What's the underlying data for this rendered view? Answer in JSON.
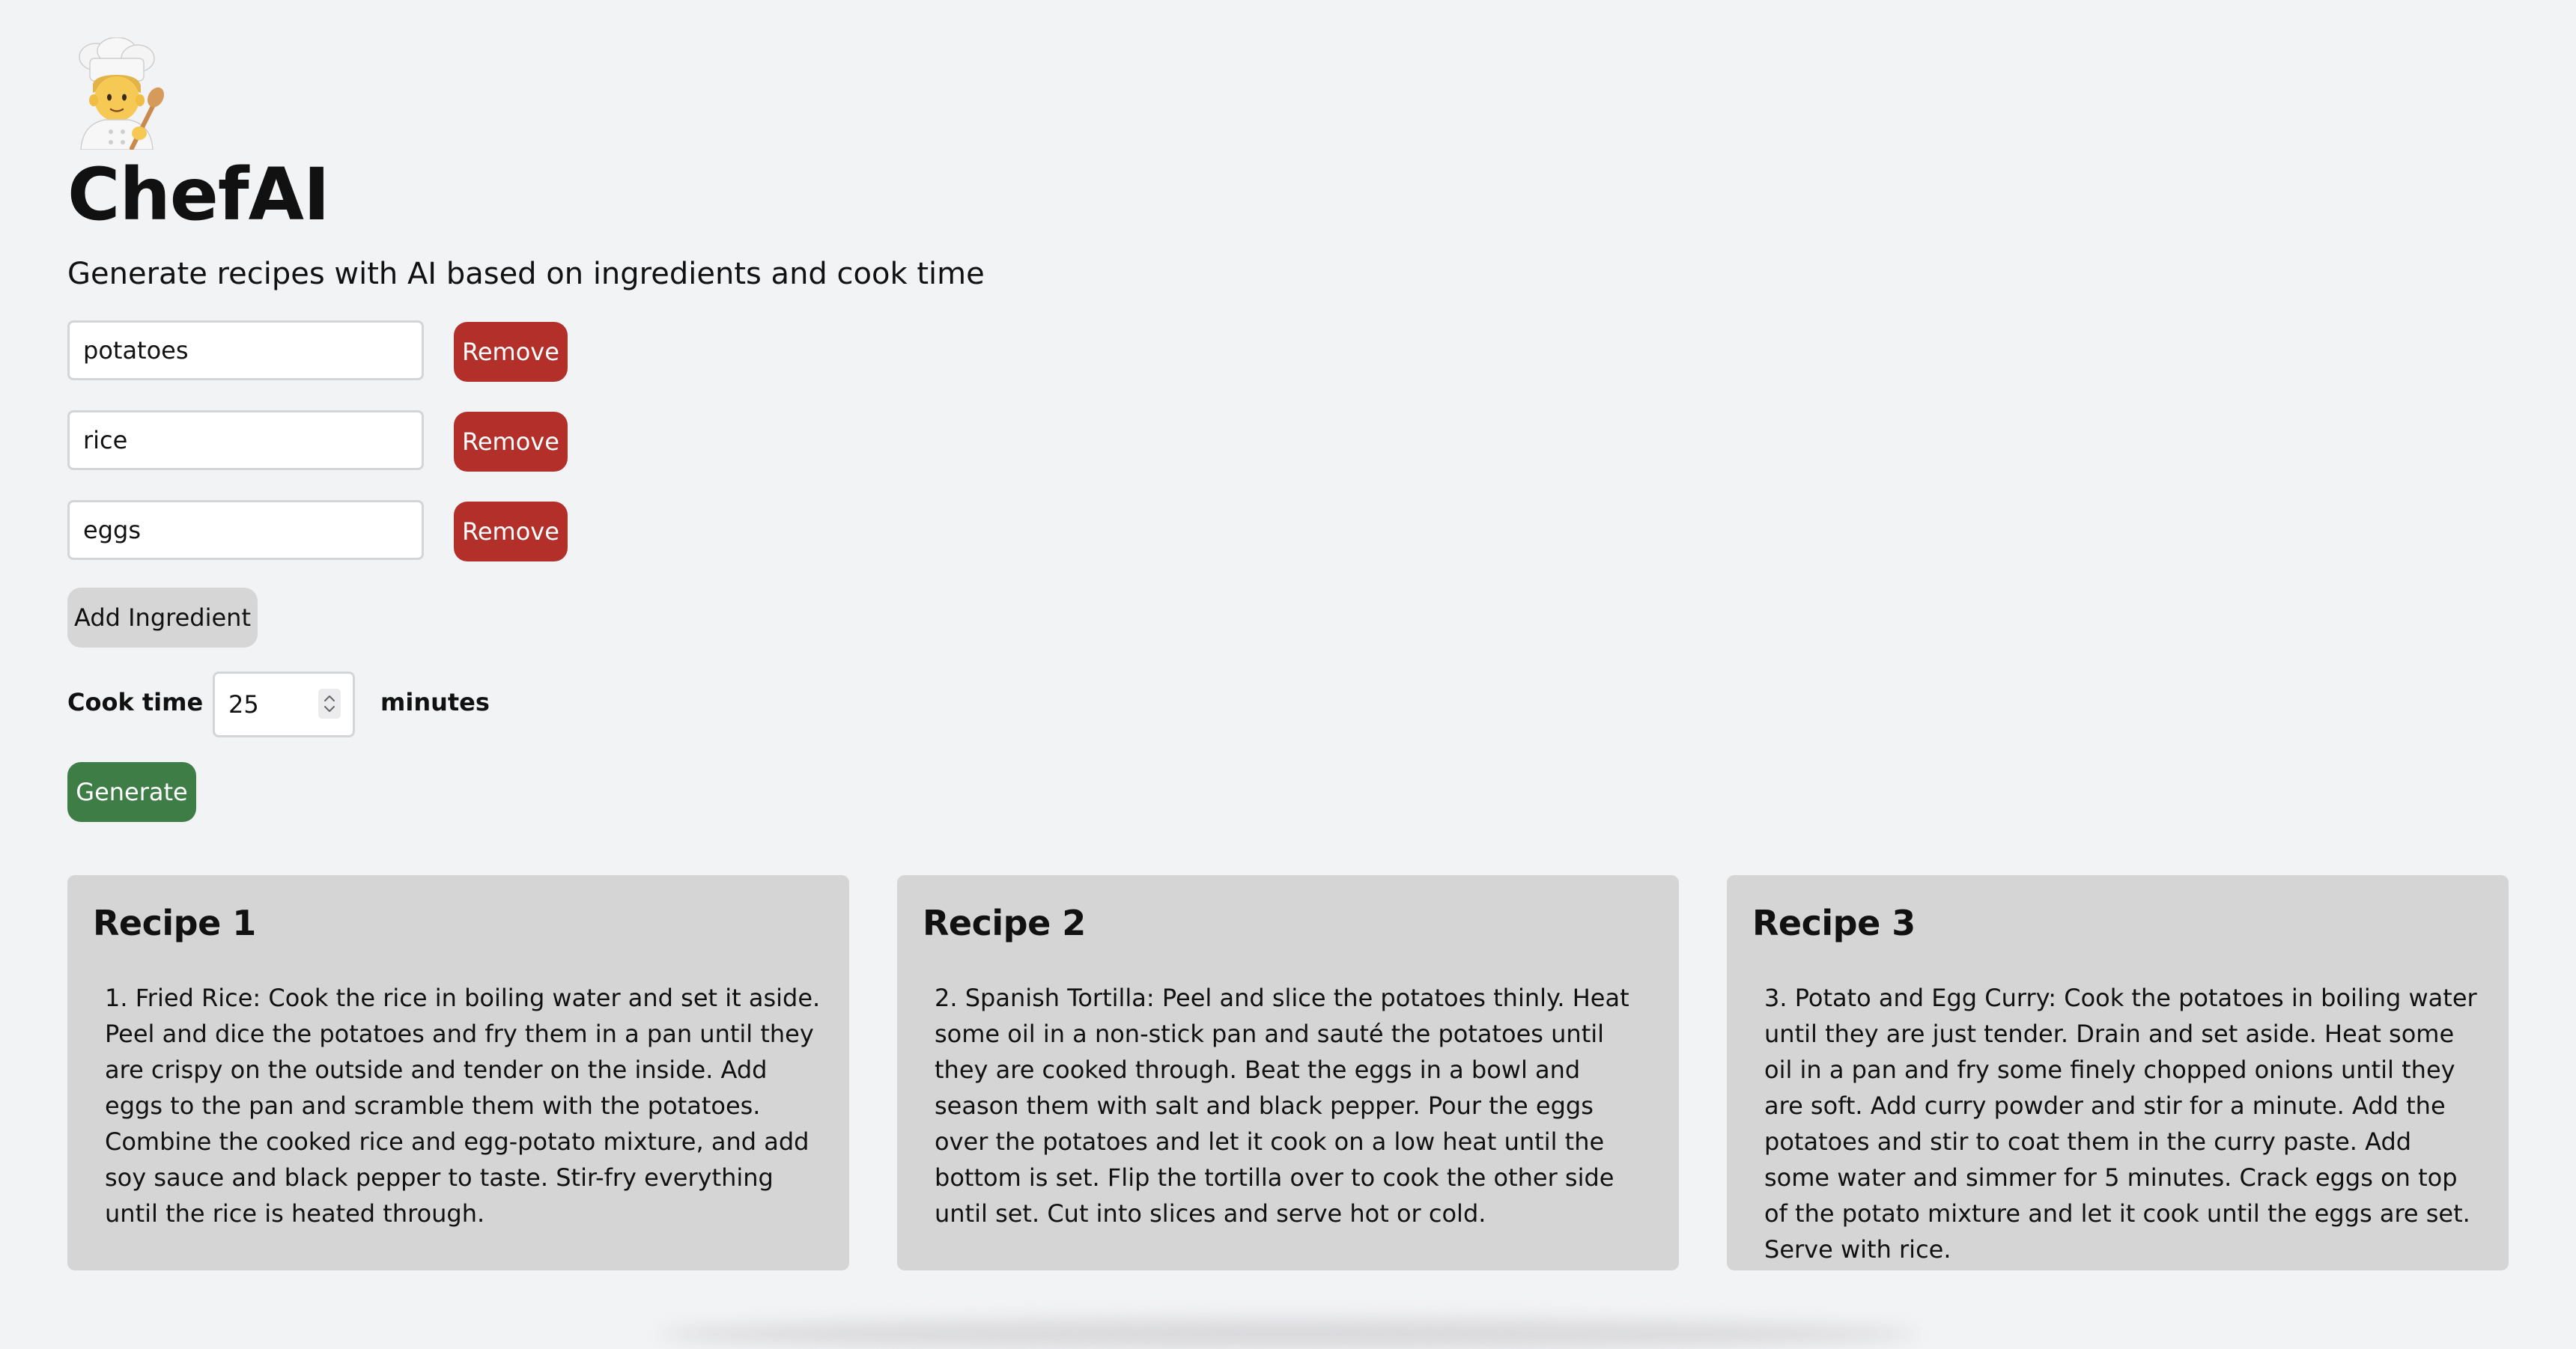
{
  "app": {
    "logo_icon": "chef-emoji-icon",
    "title": "ChefAI",
    "subtitle": "Generate recipes with AI based on ingredients and cook time"
  },
  "ingredients": [
    {
      "value": "potatoes",
      "remove_label": "Remove"
    },
    {
      "value": "rice",
      "remove_label": "Remove"
    },
    {
      "value": "eggs",
      "remove_label": "Remove"
    }
  ],
  "add_ingredient_label": "Add Ingredient",
  "cook_time": {
    "label": "Cook time",
    "value": "25",
    "unit": "minutes"
  },
  "generate_label": "Generate",
  "colors": {
    "remove": "#b3302a",
    "generate": "#3f7d47",
    "card": "#d5d5d5",
    "background": "#f2f3f5"
  },
  "recipes": [
    {
      "title": "Recipe 1",
      "body": "1. Fried Rice: Cook the rice in boiling water and set it aside. Peel and dice the potatoes and fry them in a pan until they are crispy on the outside and tender on the inside. Add eggs to the pan and scramble them with the potatoes. Combine the cooked rice and egg-potato mixture, and add soy sauce and black pepper to taste. Stir-fry everything until the rice is heated through."
    },
    {
      "title": "Recipe 2",
      "body": "2. Spanish Tortilla: Peel and slice the potatoes thinly. Heat some oil in a non-stick pan and sauté the potatoes until they are cooked through. Beat the eggs in a bowl and season them with salt and black pepper. Pour the eggs over the potatoes and let it cook on a low heat until the bottom is set. Flip the tortilla over to cook the other side until set. Cut into slices and serve hot or cold."
    },
    {
      "title": "Recipe 3",
      "body": "3. Potato and Egg Curry: Cook the potatoes in boiling water until they are just tender. Drain and set aside. Heat some oil in a pan and fry some finely chopped onions until they are soft. Add curry powder and stir for a minute. Add the potatoes and stir to coat them in the curry paste. Add some water and simmer for 5 minutes. Crack eggs on top of the potato mixture and let it cook until the eggs are set. Serve with rice."
    }
  ]
}
